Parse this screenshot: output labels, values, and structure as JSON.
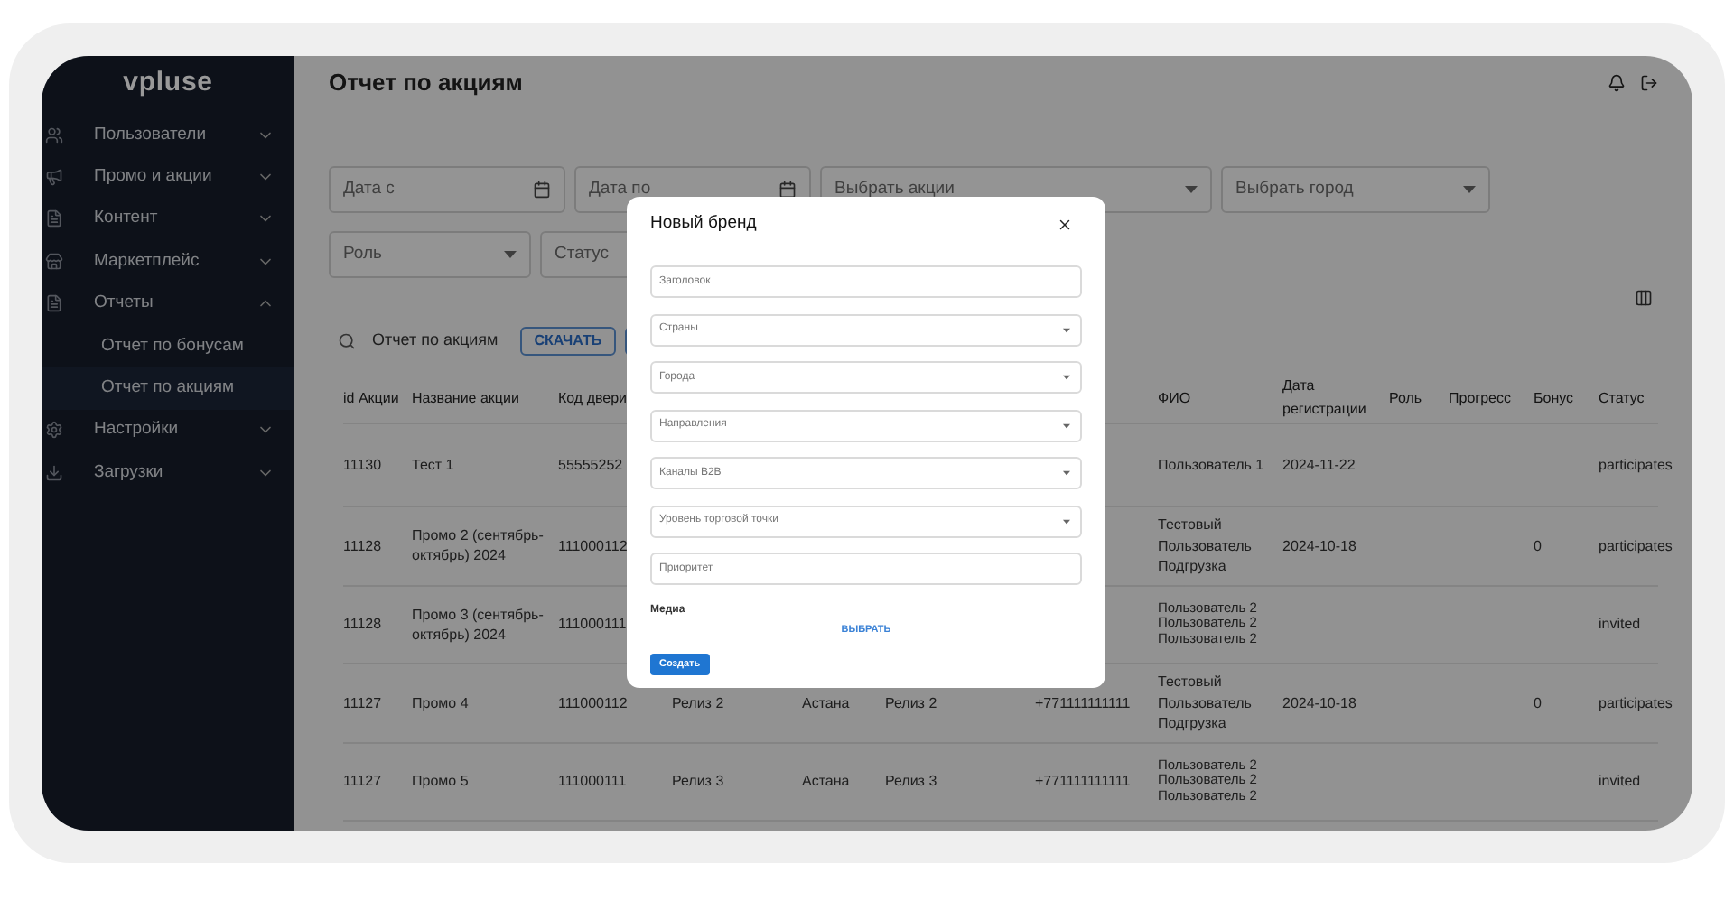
{
  "sidebar": {
    "logo": "vpluse",
    "items": [
      {
        "label": "Пользователи",
        "expanded": false
      },
      {
        "label": "Промо и акции",
        "expanded": false
      },
      {
        "label": "Контент",
        "expanded": false
      },
      {
        "label": "Маркетплейс",
        "expanded": false
      },
      {
        "label": "Отчеты",
        "expanded": true,
        "children": [
          {
            "label": "Отчет по бонусам",
            "selected": false
          },
          {
            "label": "Отчет по акциям",
            "selected": true
          }
        ]
      },
      {
        "label": "Настройки",
        "expanded": false
      },
      {
        "label": "Загрузки",
        "expanded": false
      }
    ]
  },
  "page_title": "Отчет по акциям",
  "filters": [
    [
      {
        "kind": "date",
        "placeholder": "Дата с"
      },
      {
        "kind": "date",
        "placeholder": "Дата по"
      },
      {
        "kind": "select",
        "placeholder": "Выбрать акции"
      },
      {
        "kind": "select",
        "placeholder": "Выбрать город"
      }
    ],
    [
      {
        "kind": "select",
        "placeholder": "Роль"
      },
      {
        "kind": "select",
        "placeholder": "Статус"
      }
    ]
  ],
  "toolbar": {
    "title": "Отчет по акциям",
    "download": "СКАЧАТЬ"
  },
  "table": {
    "columns": [
      "id Акции",
      "Название акции",
      "Код двери",
      null,
      null,
      null,
      null,
      "ФИО",
      "Дата регистрации",
      "Роль",
      "Прогресс",
      "Бонус",
      "Статус"
    ],
    "rows": [
      [
        "11130",
        "Тест 1",
        "55555252",
        null,
        null,
        null,
        null,
        "Пользователь 1",
        "2024-11-22",
        null,
        null,
        null,
        "participates"
      ],
      [
        "11128",
        "Промо 2 (сентябрь-октябрь) 2024",
        "111000112",
        null,
        null,
        null,
        null,
        "Тестовый Пользователь Подгрузка",
        "2024-10-18",
        null,
        null,
        "0",
        "participates"
      ],
      [
        "11128",
        "Промо 3 (сентябрь-октябрь) 2024",
        "111000111",
        null,
        null,
        null,
        null,
        "Пользователь 2 Пользователь 2 Пользователь 2",
        null,
        null,
        null,
        null,
        "invited"
      ],
      [
        "11127",
        "Промо 4",
        "111000112",
        "Релиз 2",
        "Астана",
        "Релиз 2",
        "+771111111111",
        "Тестовый Пользователь Подгрузка",
        "2024-10-18",
        null,
        null,
        "0",
        "participates"
      ],
      [
        "11127",
        "Промо 5",
        "111000111",
        "Релиз 3",
        "Астана",
        "Релиз 3",
        "+771111111111",
        "Пользователь 2 Пользователь 2 Пользователь 2",
        null,
        null,
        null,
        null,
        "invited"
      ]
    ]
  },
  "modal": {
    "title": "Новый бренд",
    "fields": [
      {
        "kind": "text",
        "placeholder": "Заголовок"
      },
      {
        "kind": "select",
        "placeholder": "Страны"
      },
      {
        "kind": "select",
        "placeholder": "Города"
      },
      {
        "kind": "select",
        "placeholder": "Направления"
      },
      {
        "kind": "select",
        "placeholder": "Каналы B2B"
      },
      {
        "kind": "select",
        "placeholder": "Уровень торговой точки"
      },
      {
        "kind": "text",
        "placeholder": "Приоритет"
      }
    ],
    "media_label": "Медиа",
    "media_button": "ВЫБРАТЬ",
    "submit": "Создать"
  }
}
